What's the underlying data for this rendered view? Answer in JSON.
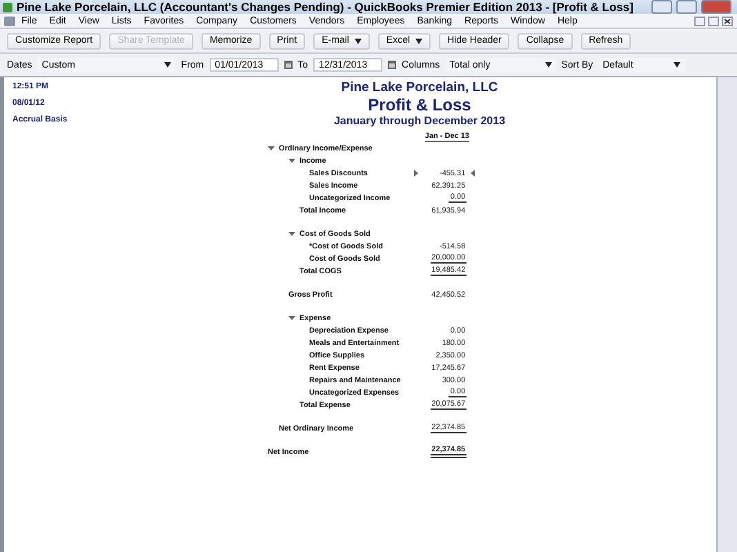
{
  "window": {
    "title": "Pine Lake Porcelain, LLC (Accountant's Changes Pending) - QuickBooks Premier Edition 2013 - [Profit & Loss]"
  },
  "menu": [
    "File",
    "Edit",
    "View",
    "Lists",
    "Favorites",
    "Company",
    "Customers",
    "Vendors",
    "Employees",
    "Banking",
    "Reports",
    "Window",
    "Help"
  ],
  "toolbar": [
    {
      "label": "Customize Report",
      "kind": "button",
      "disabled": false
    },
    {
      "label": "Share Template",
      "kind": "button",
      "disabled": true
    },
    {
      "label": "Memorize",
      "kind": "button",
      "disabled": false
    },
    {
      "label": "Print",
      "kind": "button",
      "disabled": false
    },
    {
      "label": "E-mail",
      "kind": "menu",
      "disabled": false
    },
    {
      "label": "Excel",
      "kind": "menu",
      "disabled": false
    },
    {
      "label": "Hide Header",
      "kind": "button",
      "disabled": false
    },
    {
      "label": "Collapse",
      "kind": "button",
      "disabled": false
    },
    {
      "label": "Refresh",
      "kind": "button",
      "disabled": false
    }
  ],
  "filters": {
    "dates_label": "Dates",
    "dates": "Custom",
    "from_label": "From",
    "from": "01/01/2013",
    "to_label": "To",
    "to": "12/31/2013",
    "columns_label": "Columns",
    "columns": "Total only",
    "sort_label": "Sort By",
    "sort": "Default"
  },
  "report": {
    "time": "12:51 PM",
    "date": "08/01/12",
    "basis": "Accrual Basis",
    "company": "Pine Lake Porcelain, LLC",
    "title": "Profit & Loss",
    "period": "January through December 2013",
    "column": "Jan - Dec 13",
    "rows": [
      {
        "kind": "group",
        "label": "Ordinary Income/Expense",
        "expanded": true,
        "children": [
          {
            "kind": "group",
            "label": "Income",
            "expanded": true,
            "children": [
              {
                "kind": "line",
                "label": "Sales Discounts",
                "value": "-455.31",
                "underlined": false,
                "selected": true
              },
              {
                "kind": "line",
                "label": "Sales Income",
                "value": "62,391.25",
                "underlined": false,
                "selected": false
              },
              {
                "kind": "line",
                "label": "Uncategorized Income",
                "value": "0.00",
                "underlined": true,
                "selected": false
              }
            ],
            "total": {
              "label": "Total Income",
              "value": "61,935.94",
              "underlined": false
            }
          },
          {
            "kind": "group",
            "label": "Cost of Goods Sold",
            "expanded": true,
            "children": [
              {
                "kind": "line",
                "label": "*Cost of Goods Sold",
                "value": "-514.58",
                "underlined": false,
                "selected": false
              },
              {
                "kind": "line",
                "label": "Cost of Goods Sold",
                "value": "20,000.00",
                "underlined": true,
                "selected": false
              }
            ],
            "total": {
              "label": "Total COGS",
              "value": "19,485.42",
              "underlined": true
            }
          },
          {
            "kind": "subtotal",
            "label": "Gross Profit",
            "value": "42,450.52",
            "underlined": false
          },
          {
            "kind": "group",
            "label": "Expense",
            "expanded": true,
            "children": [
              {
                "kind": "line",
                "label": "Depreciation Expense",
                "value": "0.00",
                "underlined": false,
                "selected": false
              },
              {
                "kind": "line",
                "label": "Meals and Entertainment",
                "value": "180.00",
                "underlined": false,
                "selected": false
              },
              {
                "kind": "line",
                "label": "Office Supplies",
                "value": "2,350.00",
                "underlined": false,
                "selected": false
              },
              {
                "kind": "line",
                "label": "Rent Expense",
                "value": "17,245.67",
                "underlined": false,
                "selected": false
              },
              {
                "kind": "line",
                "label": "Repairs and Maintenance",
                "value": "300.00",
                "underlined": false,
                "selected": false
              },
              {
                "kind": "line",
                "label": "Uncategorized Expenses",
                "value": "0.00",
                "underlined": true,
                "selected": false
              }
            ],
            "total": {
              "label": "Total Expense",
              "value": "20,075.67",
              "underlined": true
            }
          }
        ],
        "total": {
          "label": "Net Ordinary Income",
          "value": "22,374.85",
          "underlined": true
        }
      },
      {
        "kind": "grand_total",
        "label": "Net Income",
        "value": "22,374.85",
        "underlined": true
      }
    ]
  }
}
